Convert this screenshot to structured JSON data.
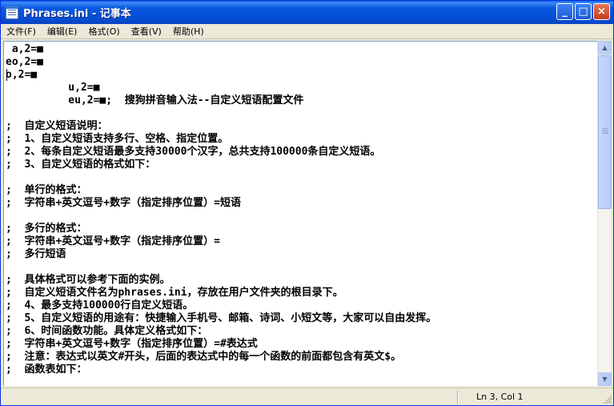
{
  "window": {
    "title": "Phrases.ini - 记事本",
    "app_icon": "notepad-icon",
    "buttons": {
      "minimize": "_",
      "maximize": "□",
      "close": "×"
    }
  },
  "menu": {
    "items": [
      "文件(F)",
      "编辑(E)",
      "格式(O)",
      "查看(V)",
      "帮助(H)"
    ]
  },
  "editor": {
    "lines": [
      " a,2=■",
      "eo,2=■",
      "o,2=■",
      "          u,2=■",
      "          eu,2=■;  搜狗拼音输入法--自定义短语配置文件",
      "",
      ";  自定义短语说明：",
      ";  1、自定义短语支持多行、空格、指定位置。",
      ";  2、每条自定义短语最多支持30000个汉字，总共支持100000条自定义短语。",
      ";  3、自定义短语的格式如下：",
      "",
      ";  单行的格式：",
      ";  字符串+英文逗号+数字（指定排序位置）=短语",
      "",
      ";  多行的格式：",
      ";  字符串+英文逗号+数字（指定排序位置）=",
      ";  多行短语",
      "",
      ";  具体格式可以参考下面的实例。",
      ";  自定义短语文件名为phrases.ini，存放在用户文件夹的根目录下。",
      ";  4、最多支持100000行自定义短语。",
      ";  5、自定义短语的用途有：快捷输入手机号、邮箱、诗词、小短文等，大家可以自由发挥。",
      ";  6、时间函数功能。具体定义格式如下：",
      ";  字符串+英文逗号+数字（指定排序位置）=#表达式",
      ";  注意：表达式以英文#开头，后面的表达式中的每一个函数的前面都包含有英文$。",
      ";  函数表如下："
    ]
  },
  "statusbar": {
    "position": "Ln 3, Col 1"
  },
  "scrollbar": {
    "up_icon": "scroll-up-arrow-icon",
    "down_icon": "scroll-down-arrow-icon"
  }
}
